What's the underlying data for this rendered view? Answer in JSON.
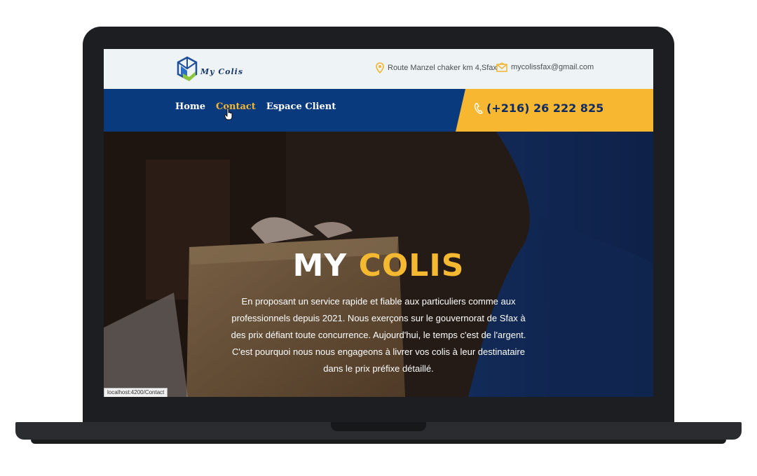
{
  "brand": {
    "logo_text": "My Colis",
    "colors": {
      "navy": "#0a3a7e",
      "accent": "#f5b831",
      "topbar": "#eef3f5"
    }
  },
  "topbar": {
    "address": "Route Manzel chaker km 4,Sfax",
    "email": "mycolissfax@gmail.com",
    "address_icon": "map-pin-icon",
    "email_icon": "envelope-icon"
  },
  "nav": {
    "items": [
      {
        "label": "Home"
      },
      {
        "label": "Contact"
      },
      {
        "label": "Espace Client"
      }
    ],
    "active": "Contact",
    "phone": "(+216) 26 222 825",
    "phone_icon": "phone-icon"
  },
  "hero": {
    "title_part1": "MY",
    "title_part2": "COLIS",
    "description": "En proposant un service rapide et fiable aux particuliers comme aux professionnels depuis 2021. Nous exerçons sur le gouvernorat de Sfax à des prix défiant toute concurrence. Aujourd'hui, le temps c'est de l'argent. C'est pourquoi nous nous engageons à livrer vos colis à leur destinataire dans le prix préfixe détaillé."
  },
  "status_bar": {
    "url": "localhost:4200/Contact"
  }
}
